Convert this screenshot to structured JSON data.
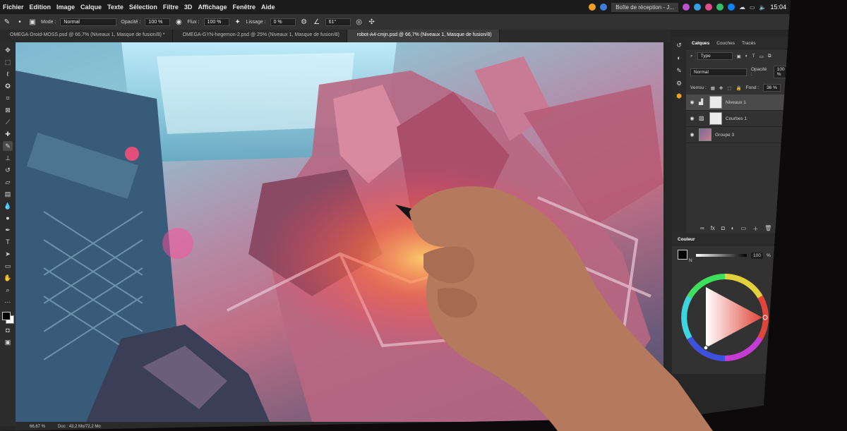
{
  "menu": {
    "items": [
      "Fichier",
      "Edition",
      "Image",
      "Calque",
      "Texte",
      "Sélection",
      "Filtre",
      "3D",
      "Affichage",
      "Fenêtre",
      "Aide"
    ]
  },
  "taskbar": {
    "window_title": "Boîte de réception - J...",
    "clock": "15:04"
  },
  "options": {
    "mode_label": "Mode :",
    "mode_value": "Normal",
    "opacity_label": "Opacité :",
    "opacity_value": "100 %",
    "flow_label": "Flux :",
    "flow_value": "100 %",
    "smoothing_label": "Lissage :",
    "smoothing_value": "0 %",
    "angle_value": "61°"
  },
  "tabs": [
    {
      "label": "OMEGA-Droid-MOSS.psd @ 66,7% (Niveaux 1, Masque de fusion/8) *"
    },
    {
      "label": "OMEGA-GYN-hegemon-2.psd @ 25% (Niveaux 1, Masque de fusion/8)"
    },
    {
      "label": "robot-A4-cmjn.psd @ 66,7% (Niveaux 1, Masque de fusion/8)"
    }
  ],
  "status": {
    "zoom": "66,67 %",
    "doc": "Doc : 43,2 Mo/72,2 Mo"
  },
  "layers_panel": {
    "tabs": [
      "Calques",
      "Couches",
      "Tracés"
    ],
    "filter_value": "Type",
    "blend_mode": "Normal",
    "opacity_label": "Opacité :",
    "opacity_value": "100 %",
    "lock_label": "Verrou :",
    "fill_label": "Fond :",
    "fill_value": "36 %",
    "layers": [
      {
        "name": "Niveaux 1"
      },
      {
        "name": "Courbes 1"
      },
      {
        "name": "Groupe 3"
      }
    ]
  },
  "color_panel": {
    "title": "Couleur",
    "value": "100",
    "unit": "%",
    "channel": "N"
  },
  "colors": {
    "panel_bg": "#323232",
    "menubar_bg": "#1c1c1c",
    "hue_marker": "#e0453a"
  }
}
